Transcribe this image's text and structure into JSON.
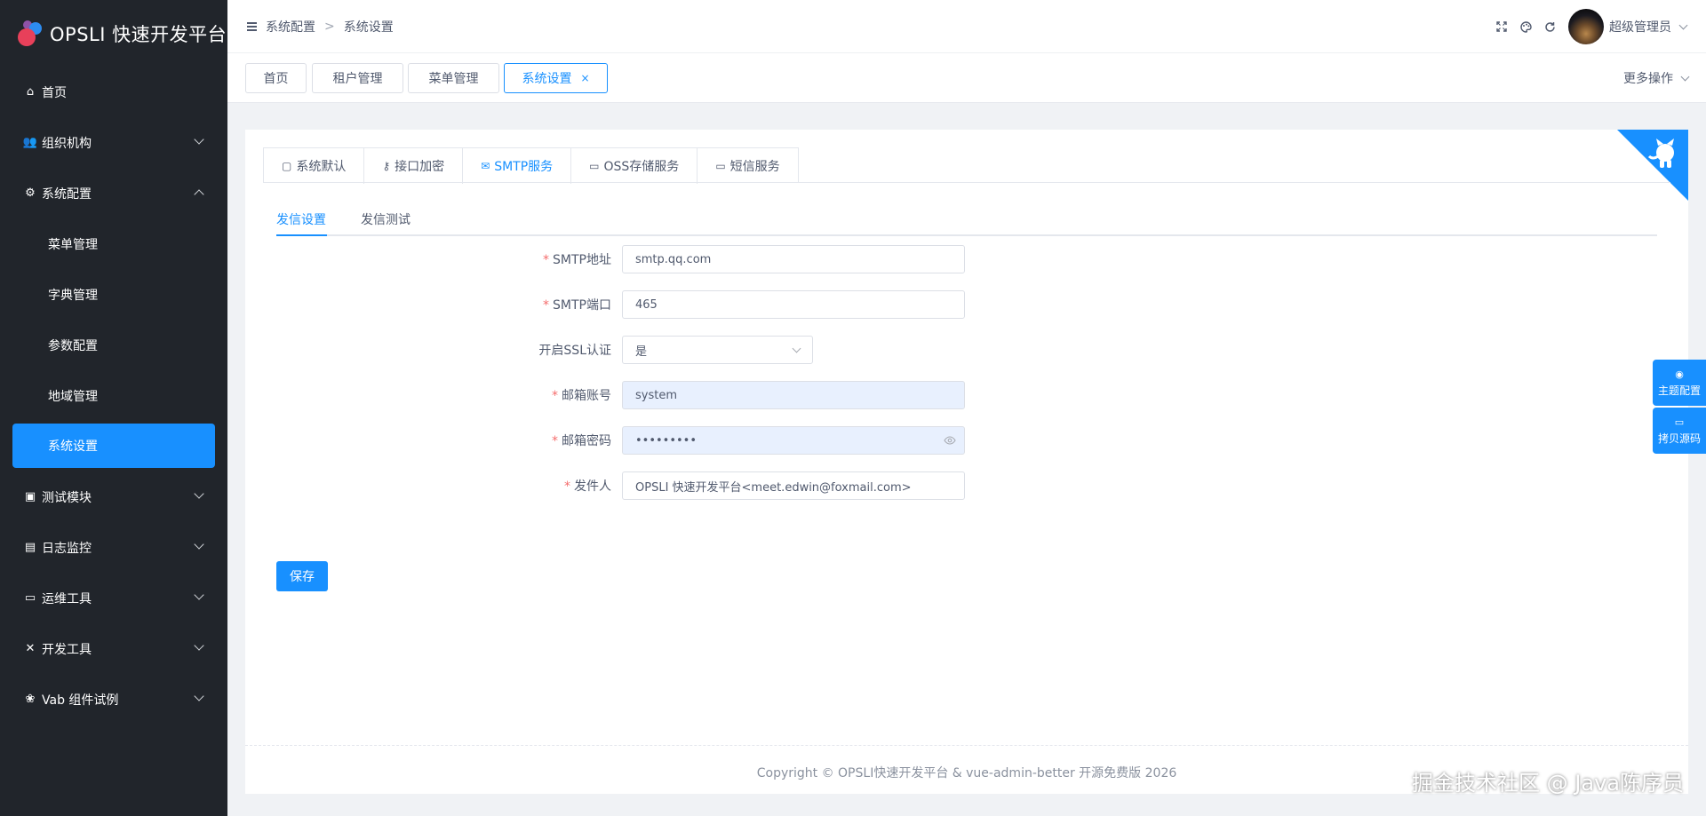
{
  "app": {
    "title": "OPSLI 快速开发平台"
  },
  "sidebar": {
    "items": [
      {
        "label": "首页",
        "icon": "home-icon"
      },
      {
        "label": "组织机构",
        "icon": "users-icon"
      },
      {
        "label": "系统配置",
        "icon": "gear-icon"
      },
      {
        "label": "测试模块",
        "icon": "box-icon"
      },
      {
        "label": "日志监控",
        "icon": "file-icon"
      },
      {
        "label": "运维工具",
        "icon": "laptop-icon"
      },
      {
        "label": "开发工具",
        "icon": "tools-icon"
      },
      {
        "label": "Vab 组件试例",
        "icon": "paw-icon"
      }
    ],
    "system_config_children": [
      {
        "label": "菜单管理"
      },
      {
        "label": "字典管理"
      },
      {
        "label": "参数配置"
      },
      {
        "label": "地域管理"
      },
      {
        "label": "系统设置"
      }
    ]
  },
  "header": {
    "breadcrumb": [
      "系统配置",
      "系统设置"
    ],
    "breadcrumb_sep": ">",
    "username": "超级管理员"
  },
  "tabs": {
    "items": [
      {
        "label": "首页"
      },
      {
        "label": "租户管理"
      },
      {
        "label": "菜单管理"
      },
      {
        "label": "系统设置"
      }
    ],
    "close_symbol": "×",
    "more": "更多操作"
  },
  "settings": {
    "tabs": [
      {
        "label": "系统默认",
        "icon": "id-card-icon"
      },
      {
        "label": "接口加密",
        "icon": "key-icon"
      },
      {
        "label": "SMTP服务",
        "icon": "mail-icon"
      },
      {
        "label": "OSS存储服务",
        "icon": "folder-icon"
      },
      {
        "label": "短信服务",
        "icon": "folder-icon"
      }
    ],
    "active_tab": "SMTP服务",
    "inner_tabs": [
      {
        "label": "发信设置"
      },
      {
        "label": "发信测试"
      }
    ]
  },
  "form": {
    "smtp_host": {
      "label": "SMTP地址",
      "value": "smtp.qq.com"
    },
    "smtp_port": {
      "label": "SMTP端口",
      "value": "465"
    },
    "ssl": {
      "label": "开启SSL认证",
      "value": "是"
    },
    "account": {
      "label": "邮箱账号",
      "value": "system"
    },
    "password": {
      "label": "邮箱密码",
      "value": "•••••••••"
    },
    "sender": {
      "label": "发件人",
      "value": "OPSLI 快速开发平台<meet.edwin@foxmail.com>"
    },
    "required_mark": "*",
    "save_label": "保存"
  },
  "footer": {
    "text": "Copyright © OPSLI快速开发平台 & vue-admin-better 开源免费版 2026"
  },
  "float": {
    "theme": "主题配置",
    "copy_source": "拷贝源码"
  },
  "watermark": "掘金技术社区 @ Java陈序员",
  "colors": {
    "primary": "#1890ff",
    "sidebar_bg": "#21252b",
    "required": "#f56c6c"
  }
}
